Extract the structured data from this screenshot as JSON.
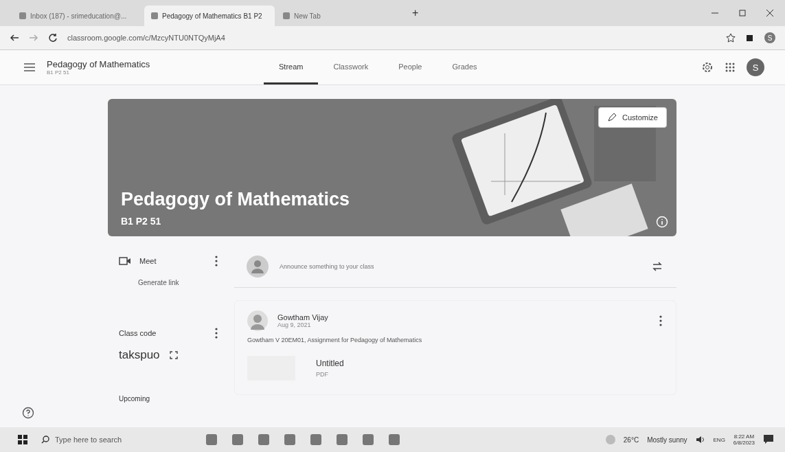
{
  "browser": {
    "tabs": [
      {
        "label": "Inbox (187) - srimeducation@...",
        "selected": false
      },
      {
        "label": "Pedagogy of Mathematics B1 P2",
        "selected": true
      },
      {
        "label": "New Tab",
        "selected": false
      }
    ],
    "new_tab": "+",
    "address": "classroom.google.com/c/MzcyNTU0NTQyMjA4",
    "profile": "S"
  },
  "header": {
    "title": "Pedagogy of Mathematics",
    "subtitle": "B1 P2 51",
    "avatar": "S",
    "nav": [
      {
        "label": "Stream",
        "selected": true
      },
      {
        "label": "Classwork",
        "selected": false
      },
      {
        "label": "People",
        "selected": false
      },
      {
        "label": "Grades",
        "selected": false
      }
    ]
  },
  "banner": {
    "title": "Pedagogy of Mathematics",
    "subtitle": "B1 P2 51",
    "customize": "Customize"
  },
  "sidebar": {
    "meet": "Meet",
    "generate": "Generate link",
    "class_code_label": "Class code",
    "class_code": "takspuo",
    "upcoming": "Upcoming"
  },
  "announce": {
    "placeholder": "Announce something to your class"
  },
  "post": {
    "author": "Gowtham Vijay",
    "date": "Aug 9, 2021",
    "text": "Gowtham V 20EM01, Assignment for Pedagogy of Mathematics",
    "attachment": "Untitled",
    "attachment_type": "PDF"
  },
  "taskbar": {
    "search": "Type here to search",
    "weather": "26°C",
    "weather_text": "Mostly sunny",
    "lang": "ENG",
    "time": "8:22 AM",
    "date": "6/8/2023"
  }
}
